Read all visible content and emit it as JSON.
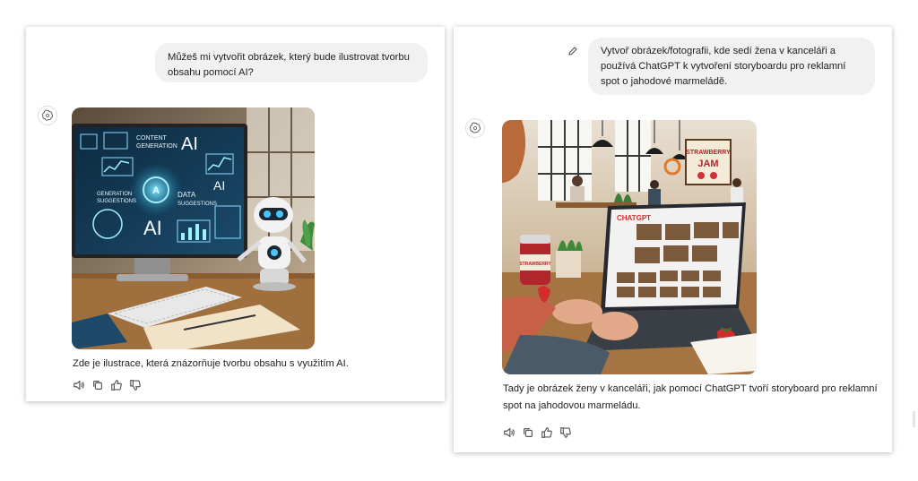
{
  "left_chat": {
    "user_message": "Můžeš mi vytvořit obrázek, který bude ilustrovat tvorbu obsahu pomocí AI?",
    "assistant_reply": "Zde je ilustrace, která znázorňuje tvorbu obsahu s využitím AI.",
    "image": {
      "subject": "generated-image-ai-content-creation",
      "screen_labels": [
        "CONTENT GENERATION",
        "AI",
        "DATA SUGGESTIONS",
        "GENERATION SUGGESTIONS"
      ]
    },
    "actions": [
      "read-aloud-icon",
      "copy-icon",
      "thumbs-up-icon",
      "thumbs-down-icon"
    ]
  },
  "right_chat": {
    "user_message": "Vytvoř obrázek/fotografii, kde sedí žena v kanceláři a používá ChatGPT k vytvoření storyboardu pro reklamní spot o jahodové marmeládě.",
    "assistant_reply": "Tady je obrázek ženy v kanceláři, jak pomocí ChatGPT tvoří storyboard pro reklamní spot na jahodovou marmeládu.",
    "image": {
      "subject": "generated-image-office-storyboard",
      "screen_labels": [
        "CHATGPT",
        "STRAWBERRY JAM",
        "STRAWBERRY"
      ]
    },
    "actions": [
      "read-aloud-icon",
      "copy-icon",
      "thumbs-up-icon",
      "thumbs-down-icon"
    ]
  }
}
